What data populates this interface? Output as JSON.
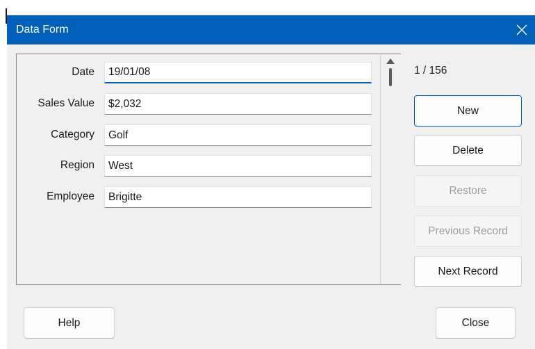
{
  "dialog": {
    "title": "Data Form",
    "close_icon": "close-icon",
    "titlebar_color": "#005fb8",
    "accent_color": "#005fb8"
  },
  "fields": [
    {
      "label": "Date",
      "value": "19/01/08"
    },
    {
      "label": "Sales Value",
      "value": "$2,032"
    },
    {
      "label": "Category",
      "value": "Golf"
    },
    {
      "label": "Region",
      "value": "West"
    },
    {
      "label": "Employee",
      "value": "Brigitte"
    }
  ],
  "record_counter": "1 / 156",
  "buttons": {
    "new": "New",
    "delete": "Delete",
    "restore": "Restore",
    "previous_record": "Previous Record",
    "next_record": "Next Record",
    "help": "Help",
    "close": "Close"
  },
  "scrollbar": {
    "up_icon": "arrow-up-icon"
  }
}
